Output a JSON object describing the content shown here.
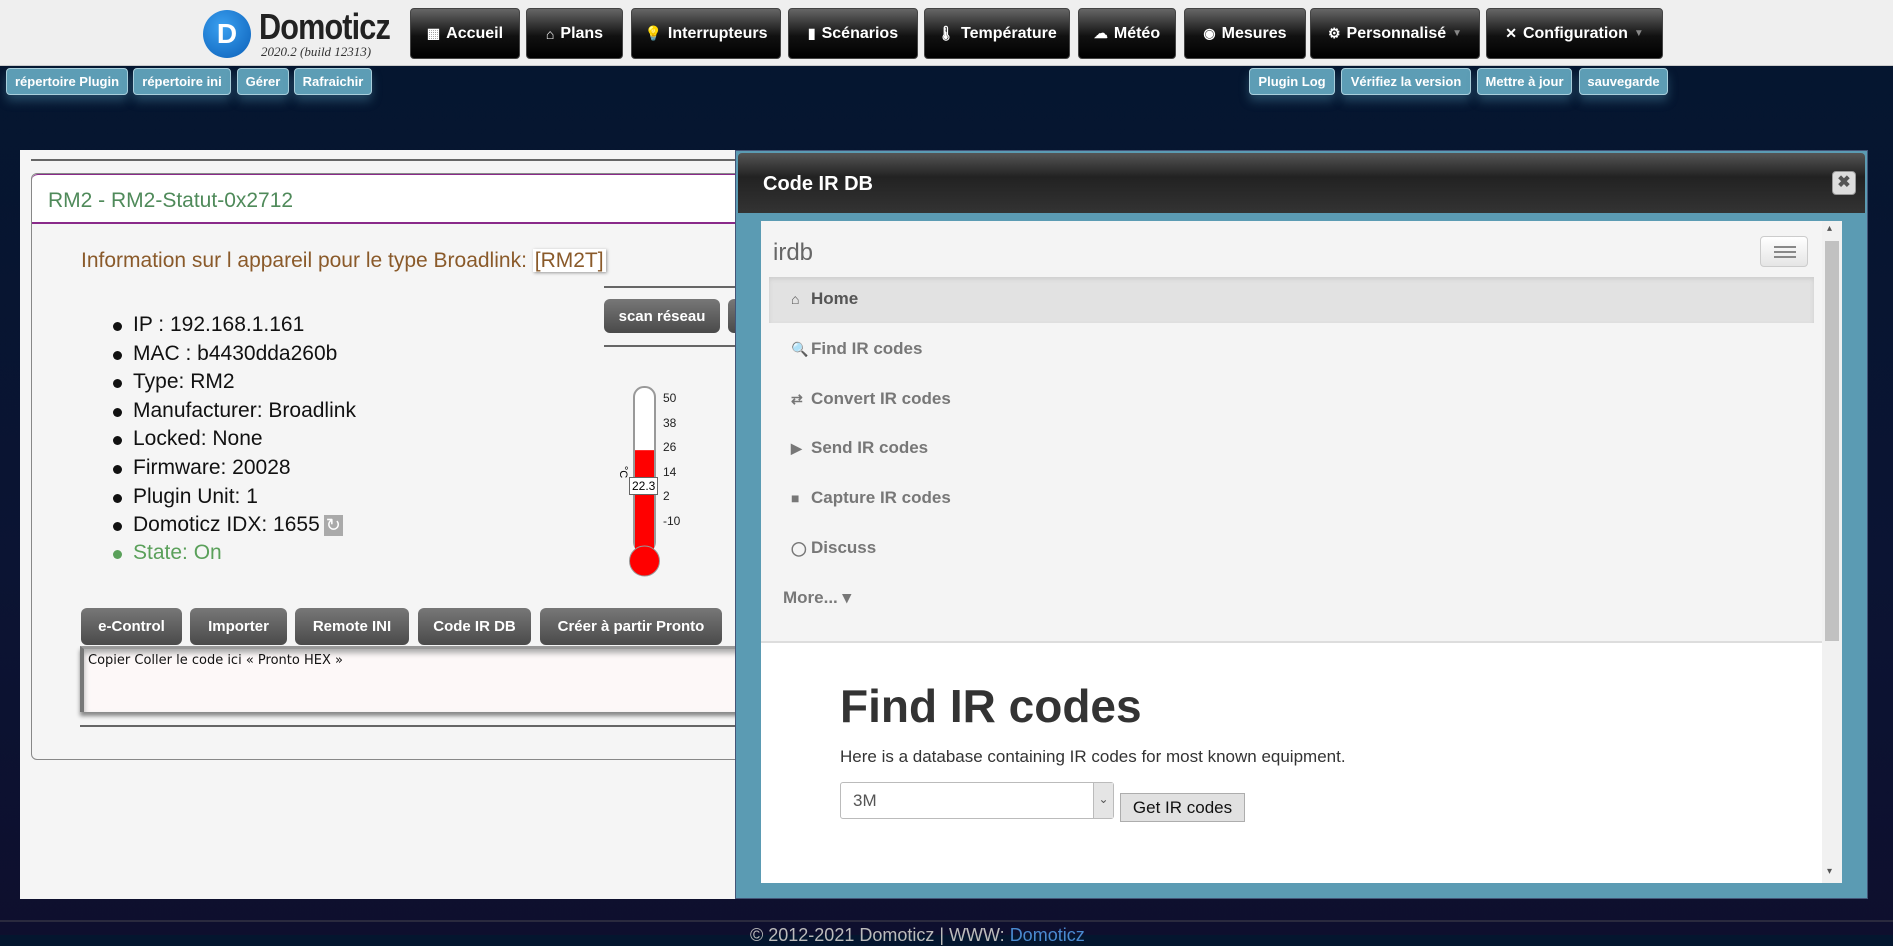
{
  "header": {
    "logo_name": "Domoticz",
    "logo_version": "2020.2 (build 12313)",
    "nav": [
      {
        "label": "Accueil",
        "icon": "dashboard-icon"
      },
      {
        "label": "Plans",
        "icon": "house-icon"
      },
      {
        "label": "Interrupteurs",
        "icon": "lightbulb-icon"
      },
      {
        "label": "Scénarios",
        "icon": "clapper-icon"
      },
      {
        "label": "Température",
        "icon": "thermometer-icon"
      },
      {
        "label": "Météo",
        "icon": "rain-cloud-icon"
      },
      {
        "label": "Mesures",
        "icon": "gauge-icon"
      },
      {
        "label": "Personnalisé",
        "icon": "gear-icon"
      },
      {
        "label": "Configuration",
        "icon": "tools-icon"
      }
    ]
  },
  "plugin_toolbar": {
    "left": [
      "répertoire Plugin",
      "répertoire ini",
      "Gérer",
      "Rafraichir"
    ],
    "right": [
      "Plugin Log",
      "Vérifiez la version",
      "Mettre à jour",
      "sauvegarde"
    ]
  },
  "card": {
    "title": "RM2 - RM2-Statut-0x2712",
    "info_prefix": "Information sur l appareil pour le type Broadlink: ",
    "info_type": "[RM2T]",
    "details": [
      "IP : 192.168.1.161",
      "MAC : b4430dda260b",
      "Type: RM2",
      "Manufacturer: Broadlink",
      "Locked: None",
      "Firmware: 20028",
      "Plugin Unit: 1",
      "Domoticz IDX: 1655"
    ],
    "state": "State: On",
    "refresh_glyph": "↻",
    "scan_button": "scan réseau",
    "thermometer": {
      "value": "22.3",
      "unit": "°C",
      "min": -10,
      "max": 50,
      "ticks": [
        "50",
        "38",
        "26",
        "14",
        "2",
        "-10"
      ],
      "fill_color": "#ff0000"
    },
    "buttons": [
      "e-Control",
      "Importer",
      "Remote INI",
      "Code IR DB",
      "Créer à partir Pronto"
    ],
    "textarea_value": "Copier Coller le code ici « Pronto HEX »"
  },
  "dialog": {
    "title": "Code IR DB",
    "close": "✖",
    "brand": "irdb",
    "menu": [
      {
        "label": "Home",
        "icon": "home-icon",
        "glyph": "⌂"
      },
      {
        "label": "Find IR codes",
        "icon": "search-icon",
        "glyph": "🔍"
      },
      {
        "label": "Convert IR codes",
        "icon": "retweet-icon",
        "glyph": "⇄"
      },
      {
        "label": "Send IR codes",
        "icon": "play-icon",
        "glyph": "▶"
      },
      {
        "label": "Capture IR codes",
        "icon": "video-camera-icon",
        "glyph": "■"
      },
      {
        "label": "Discuss",
        "icon": "comment-icon",
        "glyph": "◯"
      },
      {
        "label": "More...",
        "icon": "caret-down-icon",
        "glyph": "▾"
      }
    ],
    "heading": "Find IR codes",
    "description": "Here is a database containing IR codes for most known equipment.",
    "select_value": "3M",
    "get_button": "Get IR codes"
  },
  "footer": {
    "text": "© 2012-2021 Domoticz | WWW: ",
    "link": "Domoticz"
  }
}
